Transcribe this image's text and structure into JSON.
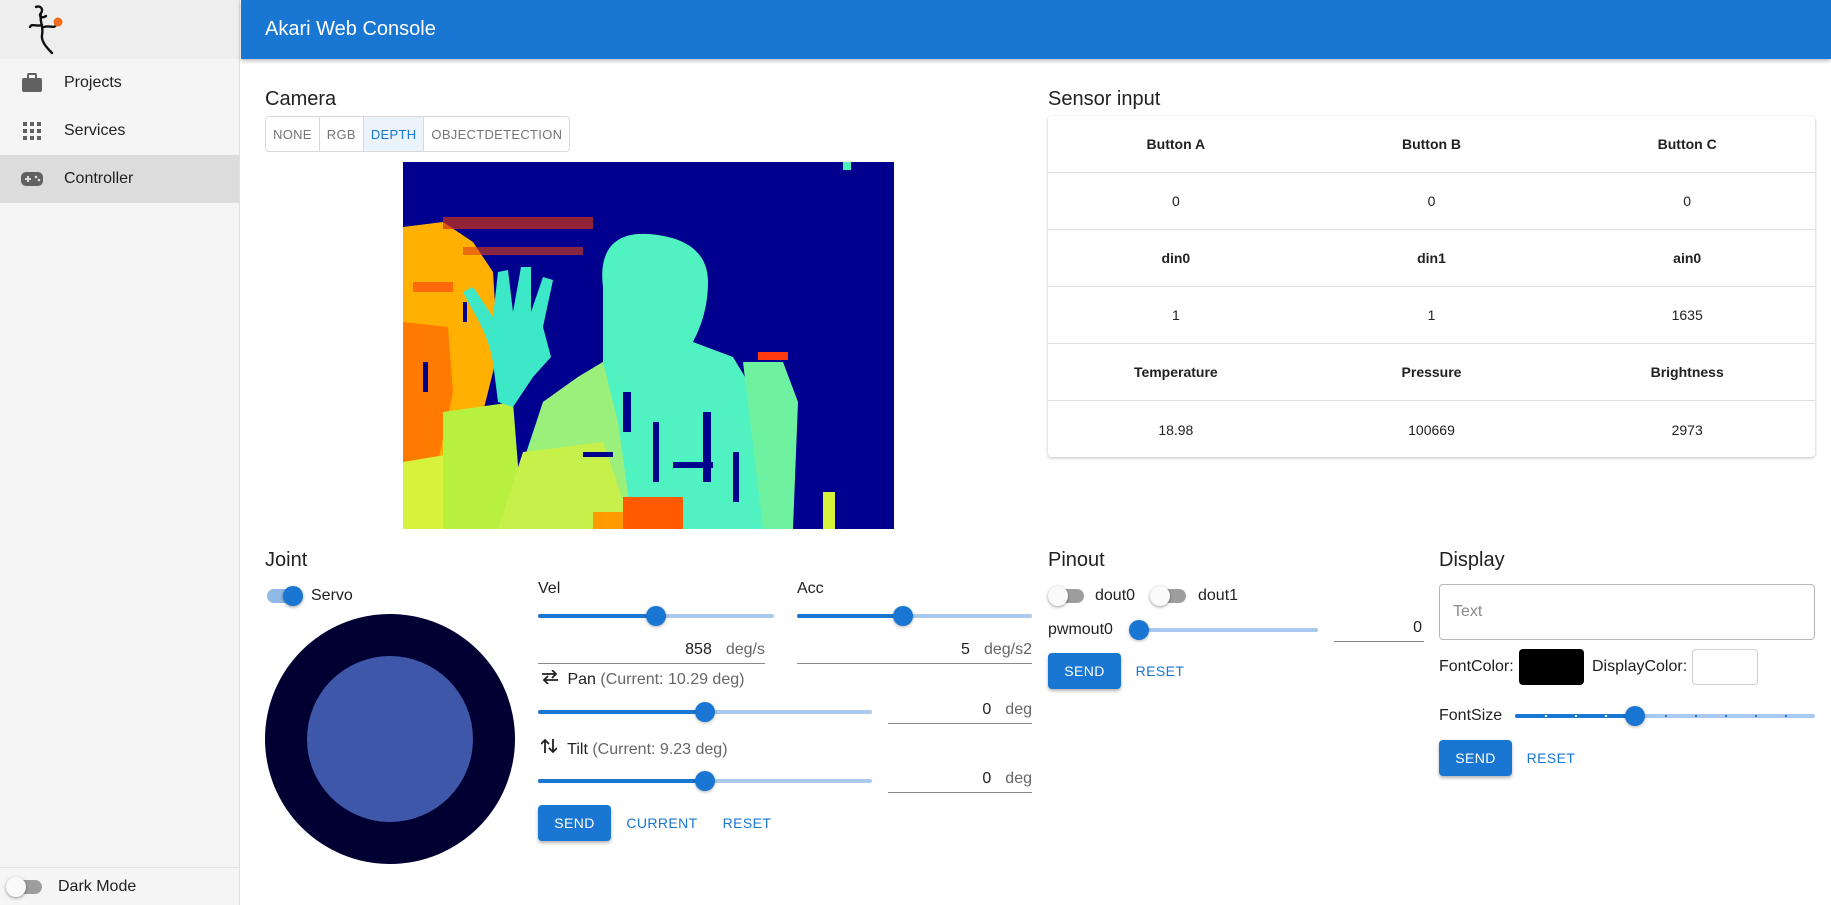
{
  "app": {
    "title": "Akari Web Console"
  },
  "sidebar": {
    "items": [
      {
        "label": "Projects",
        "icon": "briefcase-icon"
      },
      {
        "label": "Services",
        "icon": "grid-icon"
      },
      {
        "label": "Controller",
        "icon": "gamepad-icon",
        "active": true
      }
    ],
    "dark_mode_label": "Dark Mode",
    "dark_mode_on": false
  },
  "camera": {
    "title": "Camera",
    "modes": [
      "NONE",
      "RGB",
      "DEPTH",
      "OBJECTDETECTION"
    ],
    "selected_mode": "DEPTH"
  },
  "sensor": {
    "title": "Sensor input",
    "rows": [
      [
        "Button A",
        "Button B",
        "Button C"
      ],
      [
        "0",
        "0",
        "0"
      ],
      [
        "din0",
        "din1",
        "ain0"
      ],
      [
        "1",
        "1",
        "1635"
      ],
      [
        "Temperature",
        "Pressure",
        "Brightness"
      ],
      [
        "18.98",
        "100669",
        "2973"
      ]
    ]
  },
  "joint": {
    "title": "Joint",
    "servo_label": "Servo",
    "servo_on": true,
    "vel": {
      "label": "Vel",
      "value": "858",
      "unit": "deg/s",
      "fraction": 0.5
    },
    "acc": {
      "label": "Acc",
      "value": "5",
      "unit": "deg/s2",
      "fraction": 0.45
    },
    "pan": {
      "label": "Pan",
      "current": "(Current: 10.29 deg)",
      "value": "0",
      "unit": "deg",
      "fraction": 0.5
    },
    "tilt": {
      "label": "Tilt",
      "current": "(Current: 9.23 deg)",
      "value": "0",
      "unit": "deg",
      "fraction": 0.5
    },
    "send_label": "SEND",
    "current_label": "CURRENT",
    "reset_label": "RESET"
  },
  "pinout": {
    "title": "Pinout",
    "dout0_label": "dout0",
    "dout1_label": "dout1",
    "pwm_label": "pwmout0",
    "pwm_value": "0",
    "pwm_fraction": 0,
    "send_label": "SEND",
    "reset_label": "RESET"
  },
  "display": {
    "title": "Display",
    "text_placeholder": "Text",
    "font_color_label": "FontColor:",
    "display_color_label": "DisplayColor:",
    "font_color": "#000000",
    "display_color": "#ffffff",
    "font_size_label": "FontSize",
    "font_size_fraction": 0.4,
    "send_label": "SEND",
    "reset_label": "RESET"
  },
  "colors": {
    "primary": "#1976d2",
    "joystick_outer": "#000033",
    "joystick_inner": "#3f57a8"
  }
}
